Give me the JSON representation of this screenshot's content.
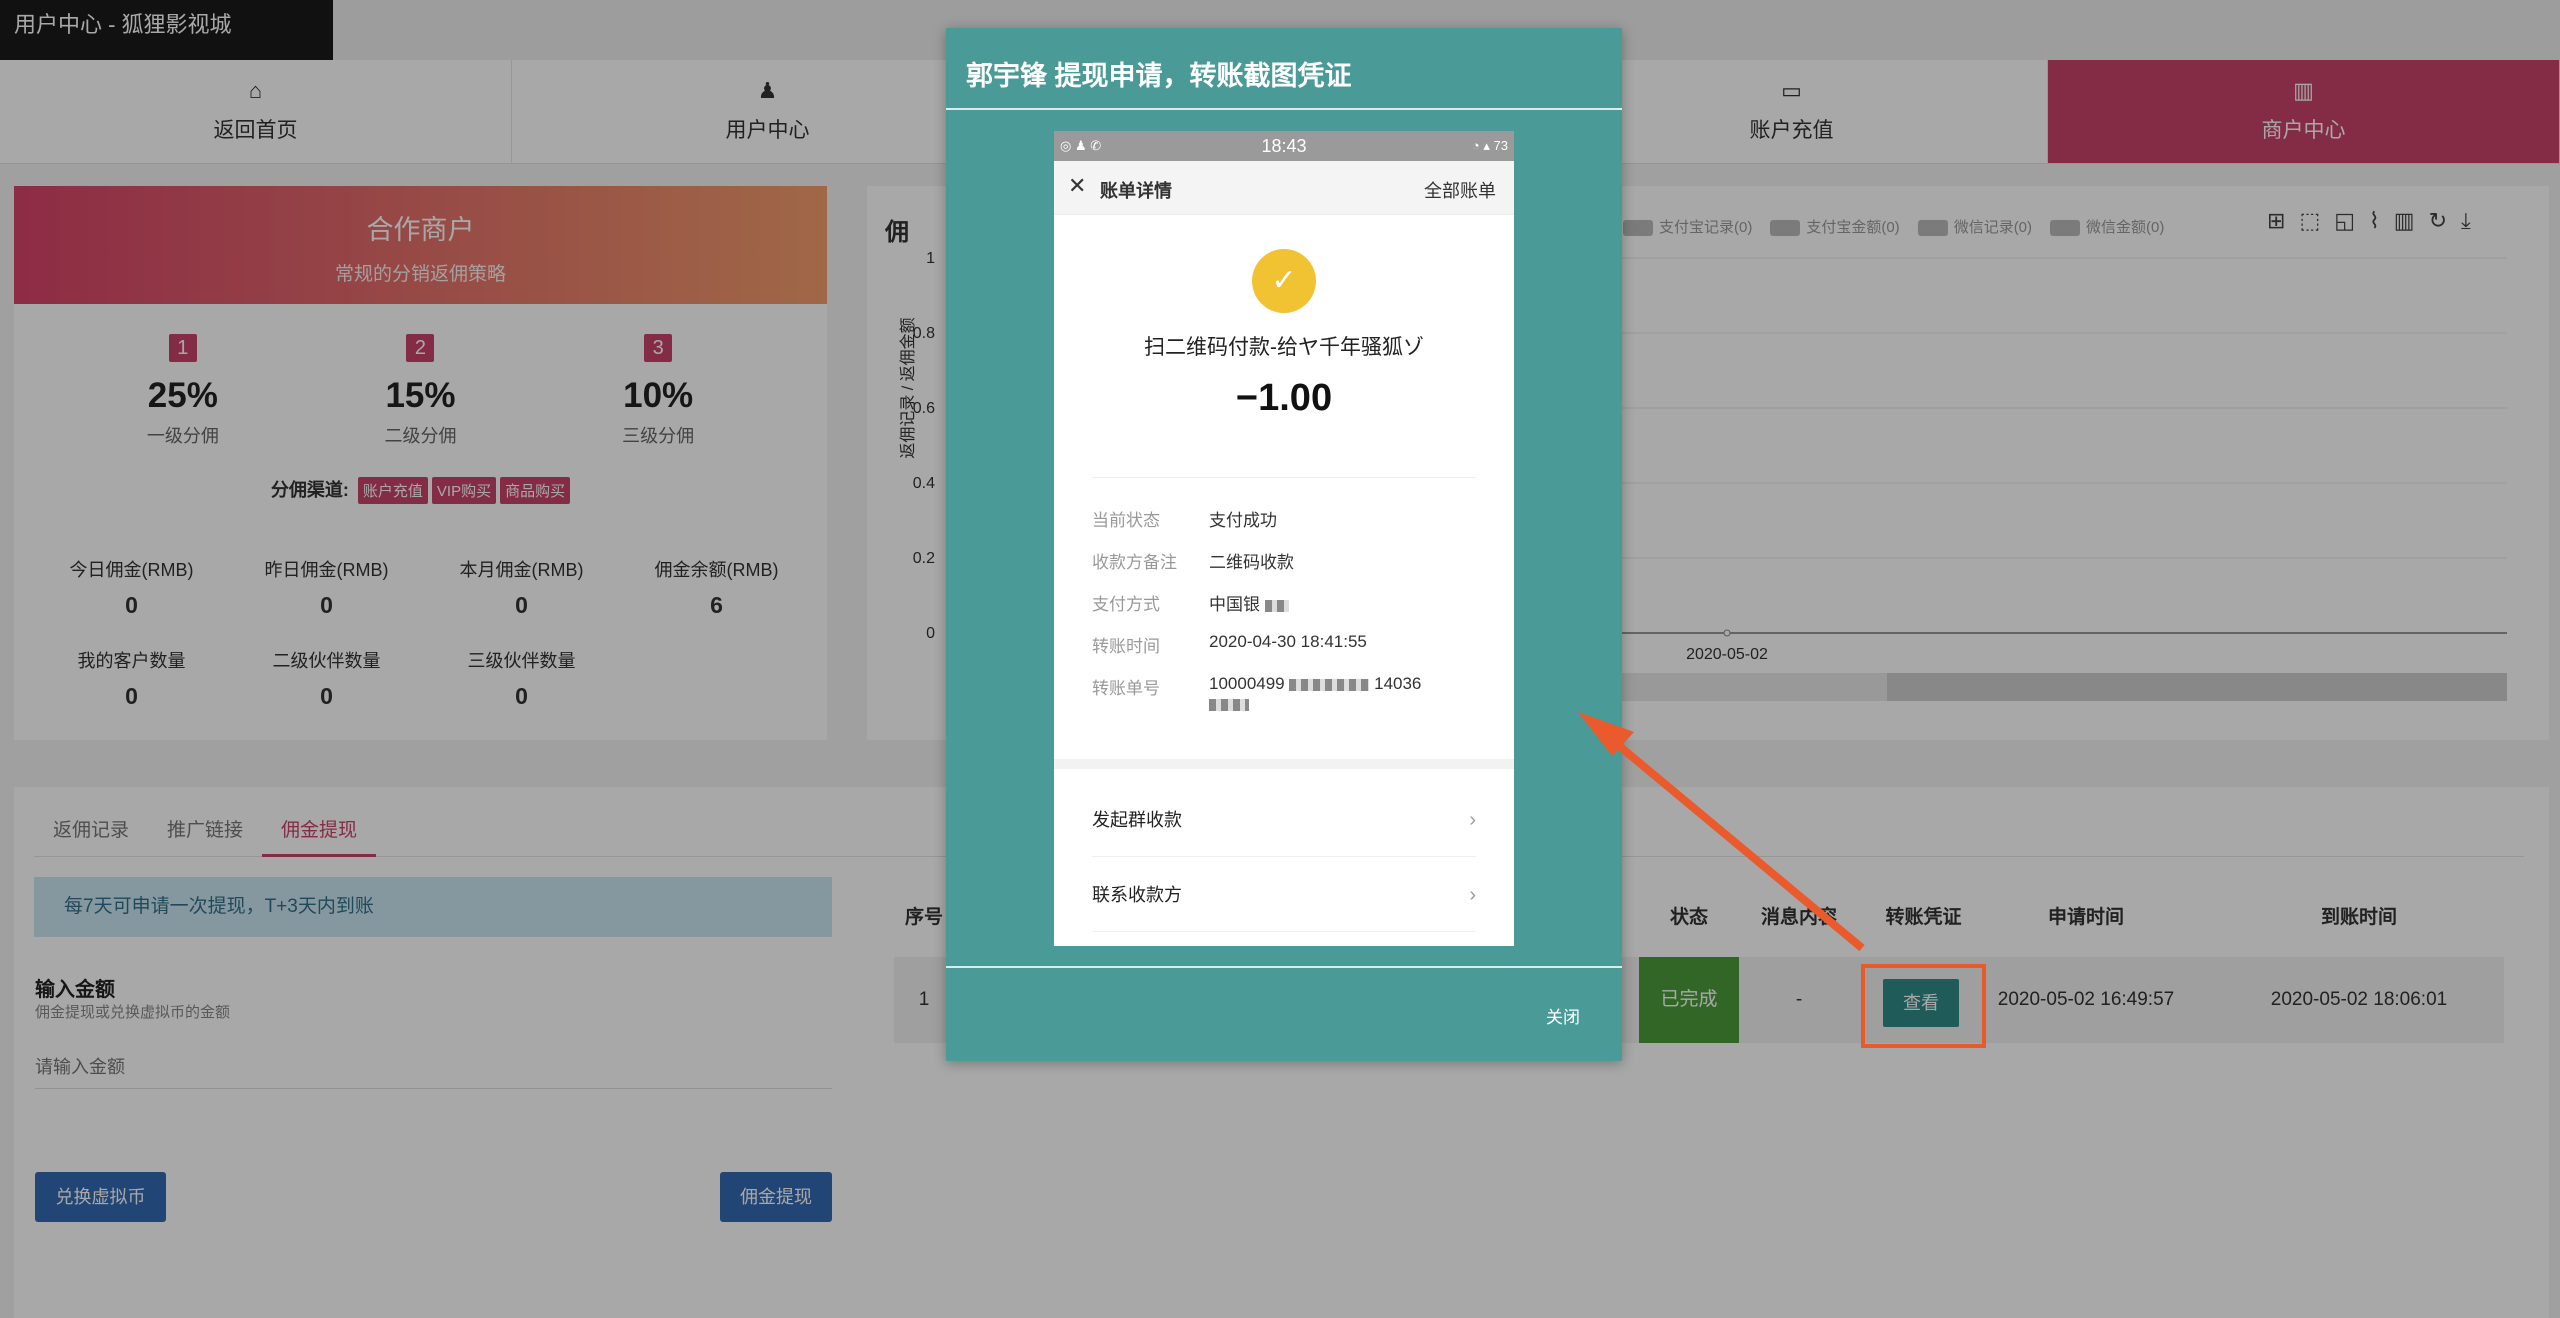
{
  "app": {
    "window_title": "用户中心 - 狐狸影视城"
  },
  "nav": {
    "items": [
      {
        "label": "返回首页",
        "icon": "home-icon"
      },
      {
        "label": "用户中心",
        "icon": "user-icon"
      },
      {
        "label": "",
        "icon": ""
      },
      {
        "label": "账户充值",
        "icon": "credit-card-icon"
      },
      {
        "label": "商户中心",
        "icon": "bar-chart-icon"
      }
    ]
  },
  "partner": {
    "title": "合作商户",
    "subtitle": "常规的分销返佣策略",
    "levels": [
      {
        "badge": "1",
        "percent": "25%",
        "label": "一级分佣"
      },
      {
        "badge": "2",
        "percent": "15%",
        "label": "二级分佣"
      },
      {
        "badge": "3",
        "percent": "10%",
        "label": "三级分佣"
      }
    ],
    "channels_label": "分佣渠道:",
    "channels": [
      "账户充值",
      "VIP购买",
      "商品购买"
    ],
    "stats": [
      {
        "label": "今日佣金(RMB)",
        "value": "0"
      },
      {
        "label": "昨日佣金(RMB)",
        "value": "0"
      },
      {
        "label": "本月佣金(RMB)",
        "value": "0"
      },
      {
        "label": "佣金余额(RMB)",
        "value": "6"
      },
      {
        "label": "我的客户数量",
        "value": "0"
      },
      {
        "label": "二级伙伴数量",
        "value": "0"
      },
      {
        "label": "三级伙伴数量",
        "value": "0"
      }
    ]
  },
  "chart": {
    "head": "佣",
    "legend": [
      "支付宝记录(0)",
      "支付宝金额(0)",
      "微信记录(0)",
      "微信金额(0)"
    ],
    "toolbox": [
      "data-view-icon",
      "zoom-icon",
      "zoom-reset-icon",
      "line-icon",
      "bar-icon",
      "restore-icon",
      "download-icon"
    ]
  },
  "chart_data": {
    "type": "line",
    "ylabel": "返佣记录 / 返佣金额",
    "y_ticks": [
      "1",
      "0.8",
      "0.6",
      "0.4",
      "0.2",
      "0"
    ],
    "ylim": [
      0,
      1
    ],
    "x": [
      "2020-05-02"
    ],
    "series": [
      {
        "name": "",
        "values": [
          0
        ]
      }
    ]
  },
  "withdraw": {
    "tabs": [
      "返佣记录",
      "推广链接",
      "佣金提现"
    ],
    "notice": "每7天可申请一次提现，T+3天内到账",
    "amount_label": "输入金额",
    "amount_hint": "佣金提现或兑换虚拟币的金额",
    "amount_placeholder": "请输入金额",
    "exchange_button": "兑换虚拟币",
    "withdraw_button": "佣金提现"
  },
  "table": {
    "headers": {
      "index": "序号",
      "status": "状态",
      "message": "消息内容",
      "proof": "转账凭证",
      "applied": "申请时间",
      "arrived": "到账时间"
    },
    "row": {
      "index": "1",
      "status": "已完成",
      "message": "-",
      "proof": "查看",
      "applied": "2020-05-02 16:49:57",
      "arrived": "2020-05-02 18:06:01"
    }
  },
  "modal": {
    "title": "郭宇锋 提现申请，转账截图凭证",
    "close": "关闭",
    "phone": {
      "time": "18:43",
      "battery": "73",
      "header_title": "账单详情",
      "header_right": "全部账单",
      "payee": "扫二维码付款-给ヤ千年骚狐ゾ",
      "amount": "−1.00",
      "details": [
        {
          "key": "当前状态",
          "value": "支付成功"
        },
        {
          "key": "收款方备注",
          "value": "二维码收款"
        },
        {
          "key": "支付方式",
          "value": "中国银"
        },
        {
          "key": "转账时间",
          "value": "2020-04-30 18:41:55"
        },
        {
          "key": "转账单号",
          "value": "10000499"
        }
      ],
      "order_suffix": "14036",
      "actions": [
        "发起群收款",
        "联系收款方"
      ]
    }
  }
}
